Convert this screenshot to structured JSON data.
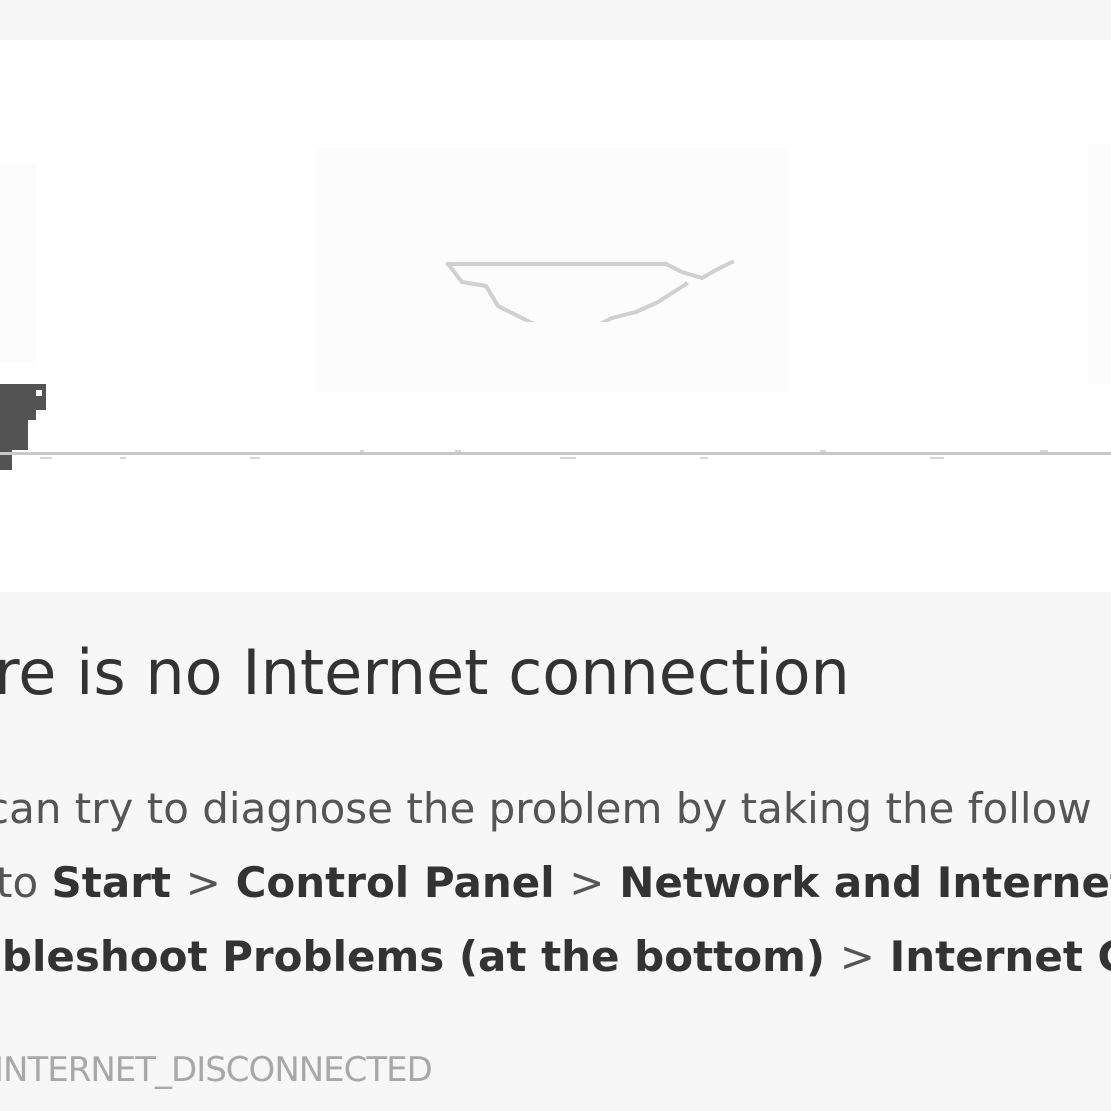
{
  "game": {
    "icons": {
      "cloud": "cloud-icon",
      "dino": "t-rex-icon",
      "ground": "horizon-line"
    }
  },
  "error": {
    "headline": "ere is no Internet connection",
    "diagnose_text": "can try to diagnose the problem by taking the follow",
    "path": {
      "lead": "to",
      "start": "Start",
      "control_panel": "Control Panel",
      "network_internet": "Network and Internet",
      "trailing_separator": ">"
    },
    "path2": {
      "troubleshoot": "ubleshoot Problems (at the bottom)",
      "internet_connections": "Internet Co"
    },
    "separator": ">",
    "code": "INTERNET_DISCONNECTED"
  },
  "colors": {
    "heading": "#333333",
    "body": "#555555",
    "code": "#a8a8a8",
    "background": "#f7f7f7"
  }
}
